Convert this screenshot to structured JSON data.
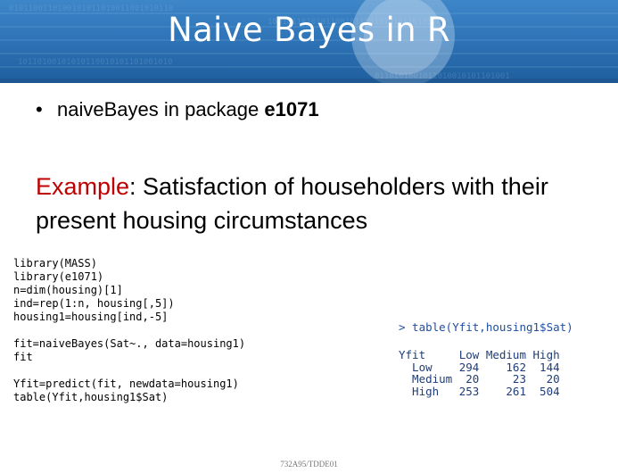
{
  "slide": {
    "title": "Naive Bayes in R",
    "bullet": {
      "text": "naiveBayes in package ",
      "bold": "e1071"
    },
    "example": {
      "lead": "Example",
      "rest": ": Satisfaction of householders with their present housing circumstances"
    },
    "code_lines": [
      "library(MASS)",
      "library(e1071)",
      "n=dim(housing)[1]",
      "ind=rep(1:n, housing[,5])",
      "housing1=housing[ind,-5]",
      "",
      "fit=naiveBayes(Sat~., data=housing1)",
      "fit",
      "",
      "Yfit=predict(fit, newdata=housing1)",
      "table(Yfit,housing1$Sat)"
    ],
    "console": {
      "command": "> table(Yfit,housing1$Sat)",
      "output_lines": [
        "Yfit     Low Medium High",
        "  Low    294    162  144",
        "  Medium  20     23   20",
        "  High   253    261  504"
      ]
    },
    "footer": "732A95/TDDE01",
    "colors": {
      "banner": "#2f75b8",
      "title_text": "#ffffff",
      "example_lead": "#c00000",
      "console_text": "#1f4fa0"
    }
  }
}
